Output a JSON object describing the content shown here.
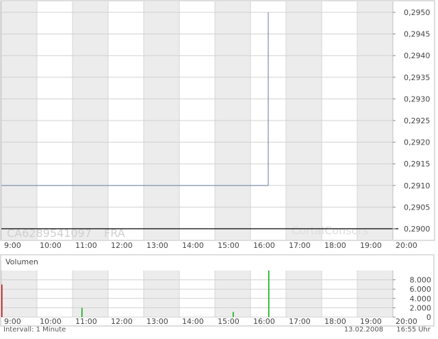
{
  "chart_data": [
    {
      "type": "line",
      "x_unit": "time of day",
      "xlim": [
        "9:00",
        "20:00"
      ],
      "x_tick_labels": [
        "9:00",
        "10:00",
        "11:00",
        "12:00",
        "13:00",
        "14:00",
        "15:00",
        "16:00",
        "17:00",
        "18:00",
        "19:00",
        "20:00"
      ],
      "ylim": [
        0.29,
        0.295
      ],
      "y_tick_labels": [
        "0,2900",
        "0,2905",
        "0,2910",
        "0,2915",
        "0,2920",
        "0,2925",
        "0,2930",
        "0,2935",
        "0,2940",
        "0,2945",
        "0,2950"
      ],
      "y_ticks": [
        0.29,
        0.2905,
        0.291,
        0.2915,
        0.292,
        0.2925,
        0.293,
        0.2935,
        0.294,
        0.2945,
        0.295
      ],
      "series": [
        {
          "points": [
            {
              "x": "9:00",
              "y": 0.291
            },
            {
              "x": "16:30",
              "y": 0.291
            },
            {
              "x": "16:30",
              "y": 0.295
            }
          ]
        }
      ],
      "grid": true,
      "watermark": {
        "isin": "CA6289541097",
        "exchange": "FRA",
        "brand": "CortalConsors"
      }
    },
    {
      "type": "bar",
      "title": "Volumen",
      "xlim": [
        "9:00",
        "20:00"
      ],
      "x_tick_labels": [
        "9:00",
        "10:00",
        "11:00",
        "12:00",
        "13:00",
        "14:00",
        "15:00",
        "16:00",
        "17:00",
        "18:00",
        "19:00",
        "20:00"
      ],
      "ylim": [
        0,
        10000
      ],
      "y_tick_labels": [
        "8.000",
        "6.000",
        "4.000",
        "2.000",
        "0"
      ],
      "y_ticks": [
        8000,
        6000,
        4000,
        2000,
        0
      ],
      "bars": [
        {
          "x": "9:00",
          "value": 7000,
          "color": "#cc0000"
        },
        {
          "x": "11:15",
          "value": 2000,
          "color": "#00aa00"
        },
        {
          "x": "15:30",
          "value": 1100,
          "color": "#00aa00"
        },
        {
          "x": "16:30",
          "value": 10000,
          "color": "#00aa00"
        }
      ]
    }
  ],
  "footer": {
    "interval": "Intervall: 1 Minute",
    "date": "13.02.2008",
    "time": "16:55 Uhr"
  }
}
